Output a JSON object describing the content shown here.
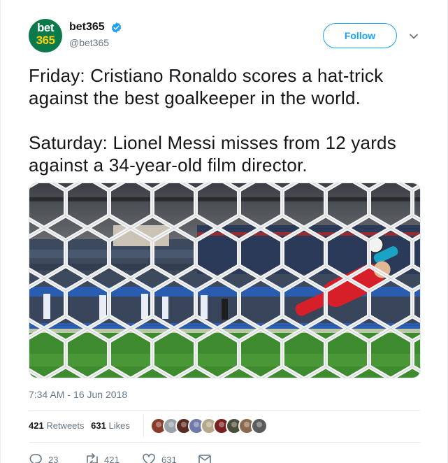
{
  "account": {
    "avatar_line1": "bet",
    "avatar_line2": "365",
    "display_name": "bet365",
    "handle": "@bet365",
    "verified": true,
    "avatar_bg": "#0b7a4a",
    "avatar_accent": "#f7d117"
  },
  "follow_button": {
    "label": "Follow",
    "color": "#1da1f2"
  },
  "menu_icon": "chevron-down-icon",
  "tweet": {
    "text": "Friday: Cristiano Ronaldo scores a hat-trick against the best goalkeeper in the world.\n\nSaturday: Lionel Messi misses from 12 yards against a 34-year-old film director."
  },
  "media": {
    "kind": "photo",
    "description_icon": "football-goal-photo"
  },
  "meta": {
    "time": "7:34 AM",
    "separator": "-",
    "date": "16 Jun 2018"
  },
  "stats": {
    "retweets_count": "421",
    "retweets_label": "Retweets",
    "likes_count": "631",
    "likes_label": "Likes"
  },
  "likers": [
    {
      "color": "#8a3b2a"
    },
    {
      "color": "#9aa3a8"
    },
    {
      "color": "#5a2a22"
    },
    {
      "color": "#6f7aa8"
    },
    {
      "color": "#b7a88a"
    },
    {
      "color": "#7a1f1f"
    },
    {
      "color": "#4a4f3a"
    },
    {
      "color": "#8c6a4f"
    },
    {
      "color": "#5c5c5c"
    }
  ],
  "actions": [
    {
      "name": "reply",
      "icon": "reply-icon",
      "count": "23"
    },
    {
      "name": "retweet",
      "icon": "retweet-icon",
      "count": "421"
    },
    {
      "name": "like",
      "icon": "heart-icon",
      "count": "631"
    },
    {
      "name": "message",
      "icon": "envelope-icon",
      "count": ""
    }
  ]
}
